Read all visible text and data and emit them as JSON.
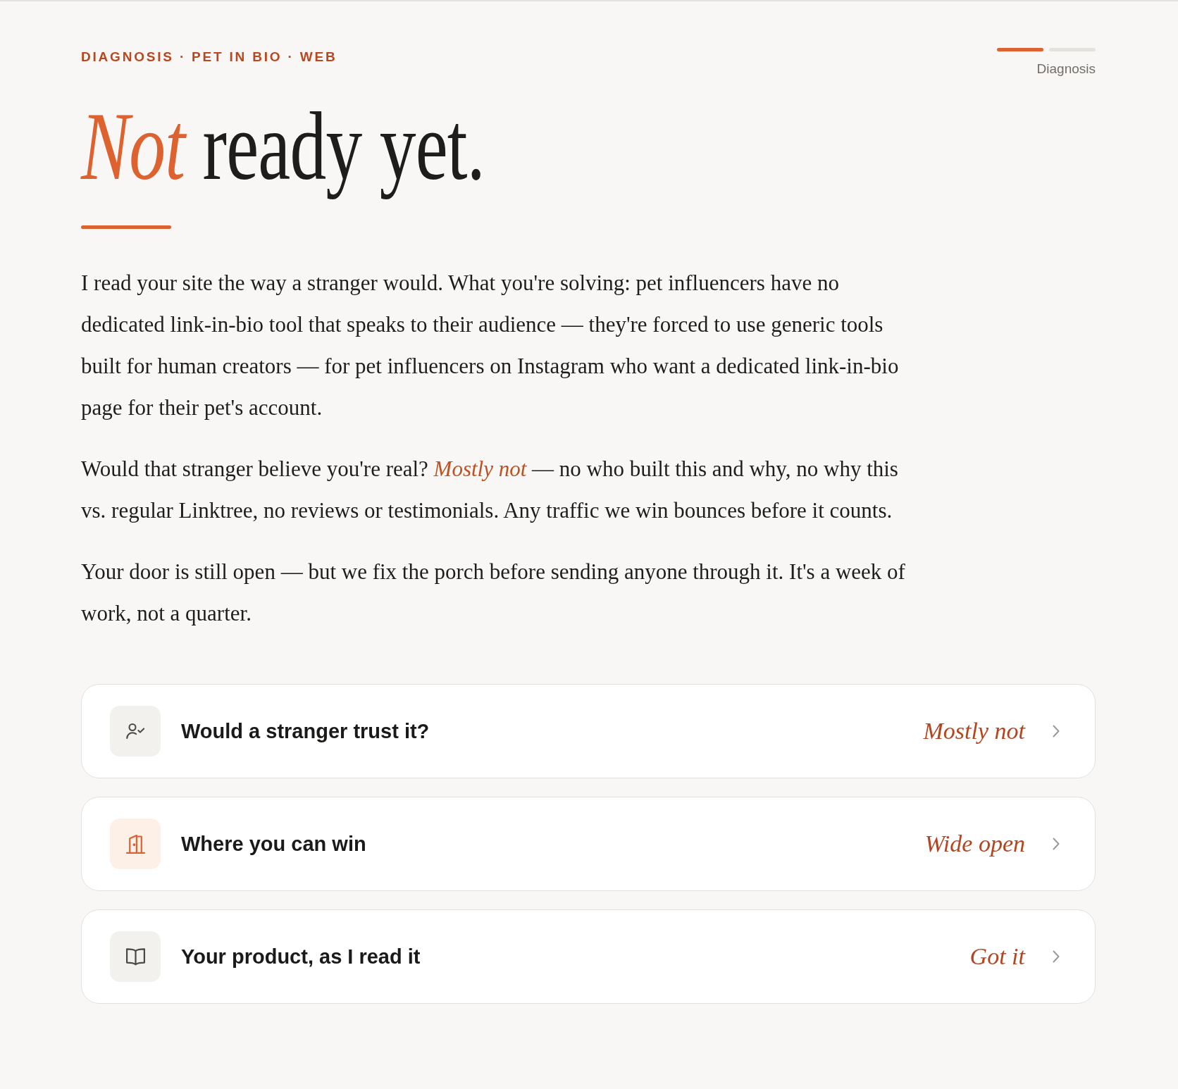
{
  "eyebrow": "DIAGNOSIS · PET IN BIO · WEB",
  "progress": {
    "steps": [
      {
        "active": true
      },
      {
        "active": false
      }
    ],
    "label": "Diagnosis"
  },
  "headline": "*Not* ready yet.",
  "paragraphs": [
    "I read your site the way a stranger would. What you're solving: pet influencers have no dedicated link-in-bio tool that speaks to their audience — they're forced to use generic tools built for human creators — for pet influencers on Instagram who want a dedicated link-in-bio page for their pet's account.",
    "Would that stranger believe you're real? *Mostly not* — no who built this and why, no why this vs. regular Linktree, no reviews or testimonials. Any traffic we win bounces before it counts.",
    "Your door is still open — but we fix the porch before sending anyone through it. It's a week of work, not a quarter."
  ],
  "cards": [
    {
      "kind": "trust",
      "title": "Would a stranger trust it?",
      "verdict": "Mostly not"
    },
    {
      "kind": "opportunity",
      "title": "Where you can win",
      "verdict": "Wide open"
    },
    {
      "kind": "product",
      "title": "Your product, as I read it",
      "verdict": "Got it"
    }
  ]
}
